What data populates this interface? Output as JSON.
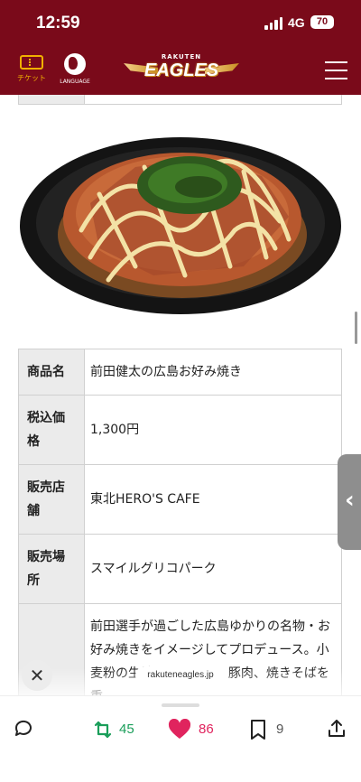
{
  "status_bar": {
    "time": "12:59",
    "network": "4G",
    "battery": "70"
  },
  "header": {
    "ticket_label": "チケット",
    "language_label": "LANGUAGE",
    "logo_top": "RAKUTEN",
    "logo_main": "EAGLES"
  },
  "product_table": {
    "rows": [
      {
        "label": "商品名",
        "value": "前田健太の広島お好み焼き"
      },
      {
        "label": "税込価格",
        "value": "1,300円"
      },
      {
        "label": "販売店舗",
        "value": "東北HERO'S CAFE"
      },
      {
        "label": "販売場所",
        "value": "スマイルグリコパーク"
      },
      {
        "label": "",
        "value": "前田選手が過ごした広島ゆかりの名物・お好み焼きをイメージしてプロデュース。小麦粉の生地にキャベツ、豚肉、焼きそばを重"
      }
    ]
  },
  "overlay": {
    "url": "rakuteneagles.jp",
    "close_symbol": "✕"
  },
  "toolbar": {
    "repost_count": "45",
    "like_count": "86",
    "bookmark_count": "9"
  },
  "colors": {
    "brand_red": "#7a0a1a",
    "repost_green": "#1a9e5a",
    "like_pink": "#e0245e"
  },
  "icons": [
    "ticket-icon",
    "globe-icon",
    "menu-icon",
    "chevron-left-icon",
    "close-icon",
    "comment-icon",
    "repost-icon",
    "heart-icon",
    "bookmark-icon",
    "share-icon"
  ]
}
